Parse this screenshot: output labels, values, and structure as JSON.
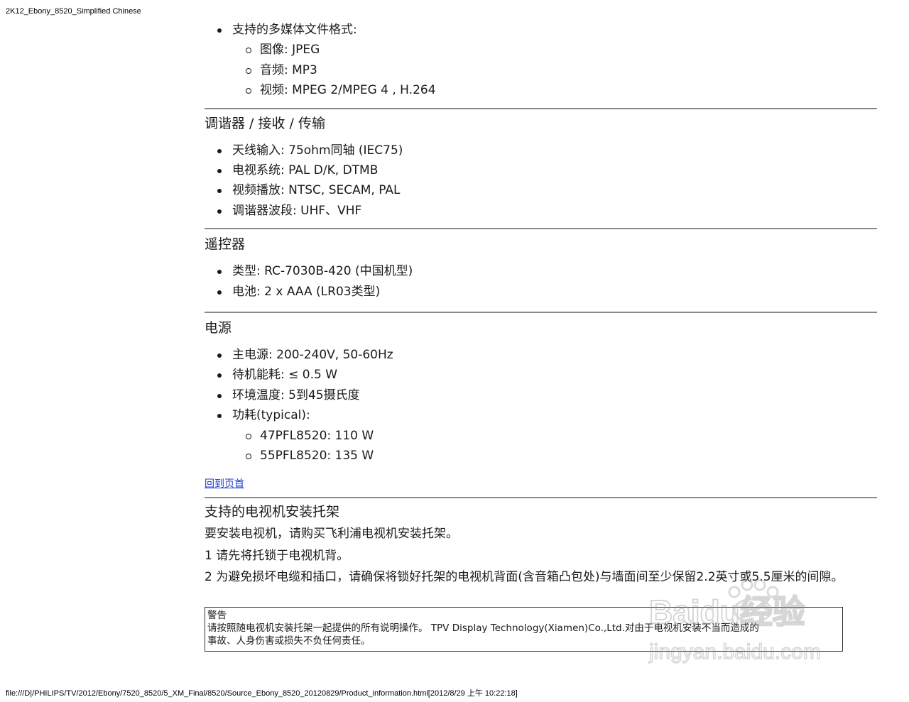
{
  "print": {
    "header": "2K12_Ebony_8520_Simplified Chinese",
    "footer": "file:///D|/PHILIPS/TV/2012/Ebony/7520_8520/5_XM_Final/8520/Source_Ebony_8520_20120829/Product_information.html[2012/8/29 上午 10:22:18]"
  },
  "multimedia": {
    "label": "支持的多媒体文件格式:",
    "items": [
      "图像: JPEG",
      "音频:  MP3",
      "视频: MPEG 2/MPEG 4 , H.264"
    ]
  },
  "tuner": {
    "title": "调谐器 / 接收 / 传输",
    "items": [
      "天线输入: 75ohm同轴 (IEC75)",
      "电视系统: PAL D/K, DTMB",
      "视频播放: NTSC, SECAM, PAL",
      "调谐器波段: UHF、VHF"
    ]
  },
  "remote": {
    "title": "遥控器",
    "items": [
      "类型: RC-7030B-420 (中国机型)",
      "电池: 2 x AAA (LR03类型)"
    ]
  },
  "power": {
    "title": "电源",
    "items": [
      "主电源: 200-240V, 50-60Hz",
      "待机能耗: ≤ 0.5 W",
      "环境温度:  5到45摄氏度",
      "功耗(typical):"
    ],
    "sub_items": [
      "47PFL8520: 110 W",
      "55PFL8520: 135 W"
    ]
  },
  "back_to_top": "回到页首",
  "bracket": {
    "title": "支持的电视机安装托架",
    "p1": "要安装电视机，请购买飞利浦电视机安装托架。",
    "p2": "1 请先将托锁于电视机背。",
    "p3": "2 为避免损坏电缆和插口，请确保将锁好托架的电视机背面(含音箱凸包处)与墙面间至少保留2.2英寸或5.5厘米的间隙。"
  },
  "warning": {
    "title": "警告",
    "line1": "请按照随电视机安装托架一起提供的所有说明操作。 TPV Display Technology(Xiamen)Co.,Ltd.对由于电视机安装不当而造成的",
    "line2": "事故、人身伤害或损失不负任何责任。"
  },
  "watermark": {
    "logo": "Baidu经验",
    "url": "jingyan.baidu.com"
  }
}
